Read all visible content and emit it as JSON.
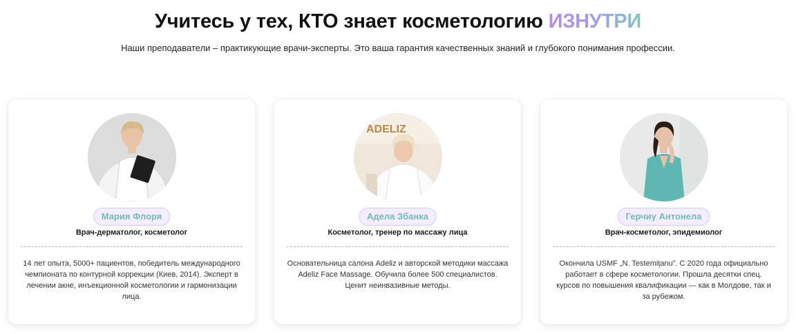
{
  "hero": {
    "title_main": "Учитесь у тех, КТО знает косметологию ",
    "title_accent": "ИЗНУТРИ",
    "subtitle": "Наши преподаватели – практикующие врачи-эксперты. Это ваша гарантия качественных знаний и глубокого понимания профессии."
  },
  "colors": {
    "accent_gradient_start": "#b88be8",
    "accent_gradient_end": "#7fc6c4",
    "badge_bg": "#f3edfd",
    "badge_text": "#6fbdbb"
  },
  "teachers": [
    {
      "name": "Мария Флоря",
      "role": "Врач-дерматолог, косметолог",
      "bio": "14 лет опыта, 5000+ пациентов, победитель международного чемпионата по контурной коррекции (Киев, 2014). Эксперт в лечении акне, инъекционной косметологии и гармонизации лица.",
      "photo_icon": "teacher-photo"
    },
    {
      "name": "Адела Збанка",
      "role": "Косметолог, тренер по массажу лица",
      "bio": "Основательница салона Adeliz и авторской методики массажа Adeliz Face Massage. Обучила более 500 специалистов. Ценит неинвазивные методы.",
      "photo_sign": "ADELIZ",
      "photo_icon": "teacher-photo"
    },
    {
      "name": "Герчиу Антонела",
      "role": "Врач-косметолог, эпидемиолог",
      "bio": "Окончила USMF „N. Testemițanu”. С 2020 года официально работает в сфере косметологии. Прошла десятки спец. курсов по повышения квалификации — как в Молдове, так и за рубежом.",
      "photo_icon": "teacher-photo"
    }
  ]
}
